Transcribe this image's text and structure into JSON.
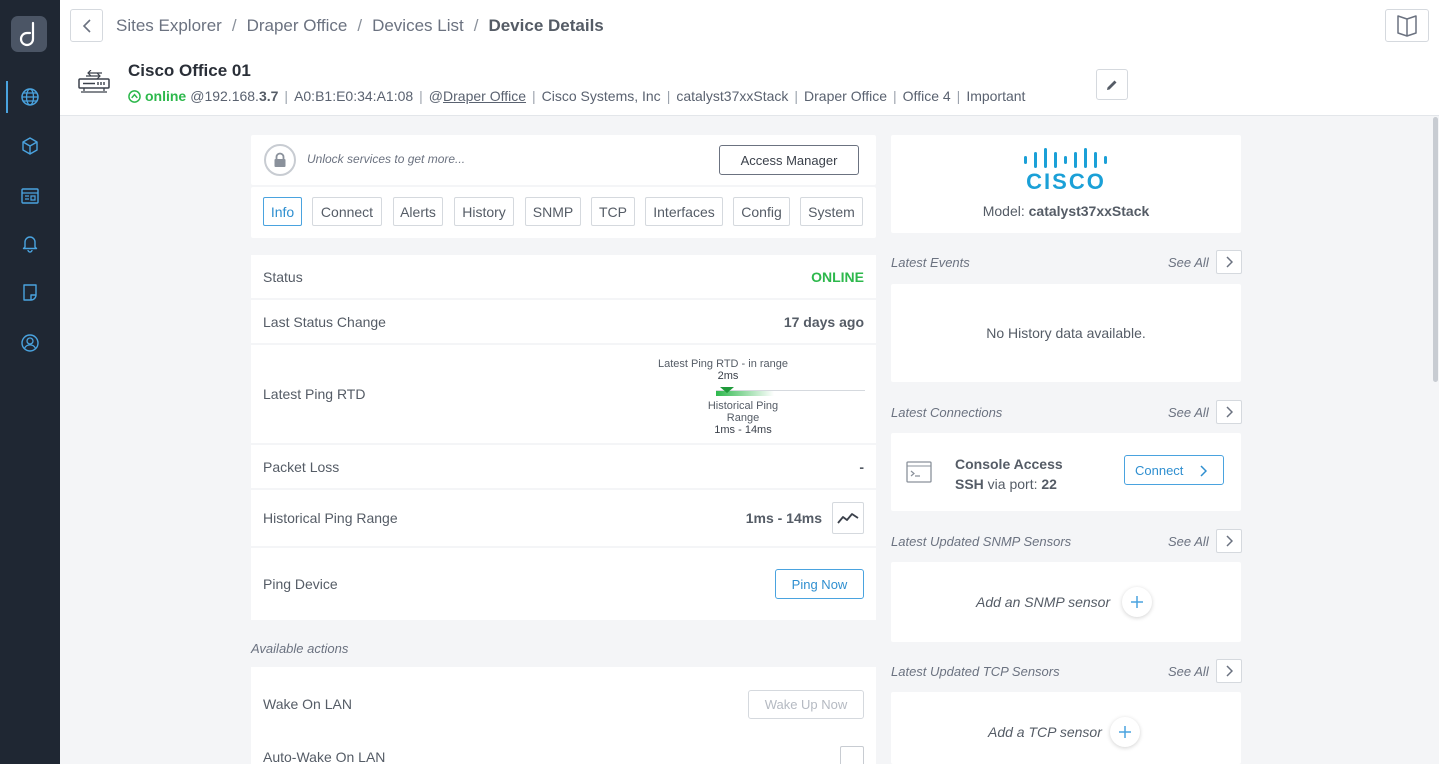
{
  "nav": {
    "logo_letter": "d",
    "items": [
      "globe-icon",
      "cube-icon",
      "dashboard-icon",
      "bell-icon",
      "report-icon",
      "user-icon"
    ]
  },
  "header": {
    "breadcrumb": [
      "Sites Explorer",
      "Draper Office",
      "Devices List",
      "Device Details"
    ],
    "separator": "/"
  },
  "device": {
    "title": "Cisco Office 01",
    "status": "online",
    "ip_prefix": "@192.168.",
    "ip_suffix": "3.7",
    "mac": "A0:B1:E0:34:A1:08",
    "site_prefix": "@",
    "site_link": "Draper Office",
    "vendor": "Cisco Systems, Inc",
    "model_name": "catalyst37xxStack",
    "location": "Draper Office",
    "room": "Office 4",
    "tag": "Important"
  },
  "unlock": {
    "text": "Unlock services to get more...",
    "button": "Access Manager"
  },
  "tabs": [
    "Info",
    "Connect",
    "Alerts",
    "History",
    "SNMP",
    "TCP",
    "Interfaces",
    "Config",
    "System"
  ],
  "info": {
    "status_label": "Status",
    "status_value": "ONLINE",
    "last_change_label": "Last Status Change",
    "last_change_value": "17 days ago",
    "ping_rtd_label": "Latest Ping RTD",
    "ping_chart": {
      "top_caption": "Latest Ping RTD - in range",
      "latest_value": "2ms",
      "range_caption_line1": "Historical Ping",
      "range_caption_line2": "Range",
      "range_value": "1ms - 14ms"
    },
    "packet_loss_label": "Packet Loss",
    "packet_loss_value": "-",
    "hist_range_label": "Historical Ping Range",
    "hist_range_value": "1ms - 14ms",
    "ping_device_label": "Ping Device",
    "ping_button": "Ping Now"
  },
  "actions": {
    "heading": "Available actions",
    "wol_label": "Wake On LAN",
    "wol_button": "Wake Up Now",
    "auto_wol_label": "Auto-Wake On LAN"
  },
  "brand": {
    "name": "CISCO",
    "model_prefix": "Model: ",
    "model": "catalyst37xxStack",
    "color": "#1ba0d7"
  },
  "right": {
    "see_all": "See All",
    "events_heading": "Latest Events",
    "events_empty": "No History data available.",
    "connections_heading": "Latest Connections",
    "console_title": "Console Access",
    "console_proto": "SSH",
    "console_via": " via port: ",
    "console_port": "22",
    "connect_button": "Connect",
    "snmp_heading": "Latest Updated SNMP Sensors",
    "snmp_add": "Add an SNMP sensor",
    "tcp_heading": "Latest Updated TCP Sensors",
    "tcp_add": "Add a TCP sensor"
  },
  "colors": {
    "online": "#2db84c",
    "accent": "#4aa3df",
    "rail": "#1f2733"
  }
}
